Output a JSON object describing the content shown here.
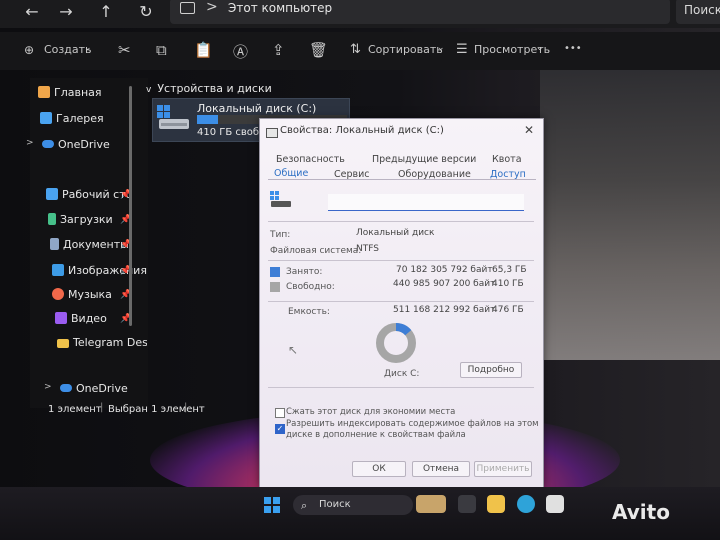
{
  "window": {
    "nav": {
      "back": "←",
      "forward": "→",
      "up": "↑",
      "refresh": "↻"
    },
    "address": {
      "separator": ">",
      "path": "Этот компьютер"
    },
    "search_placeholder": "Поиск в"
  },
  "toolbar": {
    "create": "Создать",
    "sort": "Сортировать",
    "view": "Просмотреть",
    "more": "•••",
    "chevron": "⌄"
  },
  "sidebar": {
    "items": [
      {
        "label": "Главная",
        "icon": "home-icon",
        "color": "#f0a64a"
      },
      {
        "label": "Галерея",
        "icon": "gallery-icon",
        "color": "#4aa3f0"
      },
      {
        "label": "OneDrive",
        "icon": "cloud-icon",
        "color": "#3d8ee6"
      },
      {
        "label": "Рабочий сто",
        "icon": "desktop-icon",
        "color": "#4aa3f0"
      },
      {
        "label": "Загрузки",
        "icon": "download-icon",
        "color": "#46c08a"
      },
      {
        "label": "Документы",
        "icon": "documents-icon",
        "color": "#8fa6c7"
      },
      {
        "label": "Изображения",
        "icon": "pictures-icon",
        "color": "#3d9be6"
      },
      {
        "label": "Музыка",
        "icon": "music-icon",
        "color": "#f0684a"
      },
      {
        "label": "Видео",
        "icon": "video-icon",
        "color": "#9a5cf0"
      },
      {
        "label": "Telegram Desktop",
        "icon": "folder-icon",
        "color": "#f0c24a"
      },
      {
        "label": "OneDrive",
        "icon": "cloud-icon",
        "color": "#3d8ee6"
      }
    ],
    "pin": "📌",
    "chevron": ">"
  },
  "content": {
    "group": "Устройства и диски",
    "group_chevron": "v",
    "drive": {
      "name": "Локальный диск (C:)",
      "free": "410 ГБ своб",
      "used_fraction": 0.138
    }
  },
  "status": {
    "count": "1 элемент",
    "selected": "Выбран 1 элемент"
  },
  "dialog": {
    "title": "Свойства: Локальный диск (C:)",
    "close": "✕",
    "tabs_row1": [
      "Безопасность",
      "Предыдущие версии",
      "Квота"
    ],
    "tabs_row2": [
      "Общие",
      "Сервис",
      "Оборудование",
      "Доступ"
    ],
    "name_value": "",
    "type_label": "Тип:",
    "type_value": "Локальный диск",
    "fs_label": "Файловая система:",
    "fs_value": "NTFS",
    "used_label": "Занято:",
    "used_bytes": "70 182 305 792 байт",
    "used_gb": "65,3 ГБ",
    "used_color": "#3e7ed6",
    "free_label": "Свободно:",
    "free_bytes": "440 985 907 200 байт",
    "free_gb": "410 ГБ",
    "free_color": "#a6a6a6",
    "cap_label": "Емкость:",
    "cap_bytes": "511 168 212 992 байт",
    "cap_gb": "476 ГБ",
    "disk_label": "Диск C:",
    "details_button": "Подробно",
    "compress_label": "Сжать этот диск для экономии места",
    "compress_checked": false,
    "index_label_1": "Разрешить индексировать содержимое файлов на этом",
    "index_label_2": "диске в дополнение к свойствам файла",
    "index_checked": true,
    "ok": "ОК",
    "cancel": "Отмена",
    "apply": "Применить"
  },
  "taskbar": {
    "search": "Поиск",
    "search_icon": "⌕"
  },
  "watermark": "Avito"
}
